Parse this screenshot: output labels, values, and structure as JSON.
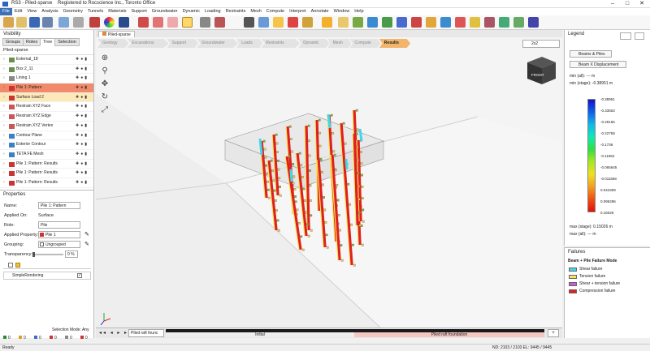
{
  "window": {
    "title": "RS3 - Piled-sparse",
    "registered": "Registered to Rocscience Inc., Toronto Office"
  },
  "menu": [
    "File",
    "Edit",
    "View",
    "Analysis",
    "Geometry",
    "Tunnels",
    "Materials",
    "Support",
    "Groundwater",
    "Dynamic",
    "Loading",
    "Restraints",
    "Mesh",
    "Compute",
    "Interpret",
    "Annotate",
    "Window",
    "Help"
  ],
  "visibility": {
    "title": "Visibility",
    "tabs": [
      "Groups",
      "Roles",
      "Tree",
      "Selection"
    ],
    "root": "Piled-sparse",
    "items": [
      {
        "label": "External_18",
        "icon": "#6b8e4e"
      },
      {
        "label": "Box 2_11",
        "icon": "#6b8e4e"
      },
      {
        "label": "Lining 1",
        "icon": "#888"
      },
      {
        "label": "Pile 1: Pattern",
        "icon": "#c33"
      },
      {
        "label": "Surface Load 2",
        "icon": "#c33"
      },
      {
        "label": "Restrain XYZ Face",
        "icon": "#c55"
      },
      {
        "label": "Restrain XYZ Edge",
        "icon": "#c55"
      },
      {
        "label": "Restrain XYZ Vertex",
        "icon": "#c55"
      },
      {
        "label": "Contour Plane",
        "icon": "#3b7fc4"
      },
      {
        "label": "Exterior Contour",
        "icon": "#3b7fc4"
      },
      {
        "label": "TETA FE Mesh",
        "icon": "#3b7fc4"
      },
      {
        "label": "Pile 1: Pattern: Results",
        "icon": "#c33"
      },
      {
        "label": "Pile 1: Pattern: Results",
        "icon": "#c33"
      },
      {
        "label": "Pile 1: Pattern: Results",
        "icon": "#c33"
      }
    ]
  },
  "properties": {
    "title": "Properties",
    "name_label": "Name:",
    "name_value": "Pile 1: Pattern",
    "applied_on_label": "Applied On:",
    "applied_on_value": "Surface",
    "role_label": "Role:",
    "role_value": "Pile",
    "applied_property_label": "Applied Property:",
    "applied_property_value": "Pile 1",
    "grouping_label": "Grouping:",
    "grouping_value": "Ungrouped",
    "transparency_label": "Transparency:",
    "transparency_value": "0 %",
    "rendering": "SimpleRendering",
    "selection_mode": "Selection Mode: Any"
  },
  "viewport": {
    "tab": "Piled-sparse",
    "workflow": [
      "Geology",
      "Excavations",
      "Support",
      "Groundwater",
      "Loads",
      "Restraints",
      "Dynamic",
      "Mesh",
      "Compute",
      "Results"
    ],
    "active_workflow": "Results",
    "layout": "2x2",
    "stages": {
      "current": "Piled raft founc",
      "stage1": "Initial",
      "stage2": "Piled raft foundation"
    }
  },
  "legend": {
    "title": "Legend",
    "filter": "Beams & Piles",
    "quantity": "Beam X Displacement",
    "min_all": "min (all): --- m",
    "min_stage": "min (stage): -0.38951 m",
    "ticks": [
      "-0.38951",
      "-0.33553",
      "-0.28155",
      "-0.22758",
      "-0.1736",
      "-0.11962",
      "-0.065645",
      "-0.011668",
      "0.042309",
      "0.096286",
      "0.15026"
    ],
    "max_stage": "max (stage): 0.15026 m",
    "max_all": "max (all): --- m"
  },
  "failures": {
    "title": "Failures",
    "heading": "Beam + Pile Failure Mode",
    "items": [
      {
        "label": "Shear failure",
        "color": "#44d6e8"
      },
      {
        "label": "Tension failure",
        "color": "#f5e45a"
      },
      {
        "label": "Shear + tension failure",
        "color": "#d25ad2"
      },
      {
        "label": "Compression failure",
        "color": "#e02020"
      }
    ]
  },
  "statusbar": {
    "left": "Ready",
    "right": "ND: 2103 / 2103 EL: 9445 / 9445",
    "counts": [
      "0",
      "0",
      "0",
      "0",
      "0",
      "0"
    ]
  }
}
